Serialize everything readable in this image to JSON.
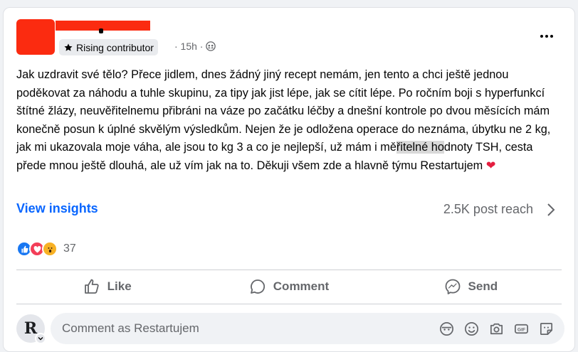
{
  "header": {
    "badge_label": "Rising contributor",
    "time": "· 15h ·"
  },
  "post": {
    "text_part1": "Jak uzdravit své tělo? Přece jidlem, dnes žádný jiný recept nemám, jen tento a chci ještě jednou poděkovat za náhodu a tuhle skupinu, za tipy jak jist lépe, jak se cítit lépe. Po ročním boji s hyperfunkcí štítné žlázy, neuvěřitelnemu přibráni  na váze po začátku léčby a dnešní kontrole po dvou měsících mám  konečně posun k úplné skvělým výsledkům. Nejen že je odložena operace do neznáma, úbytku ne 2 kg, jak mi ukazovala moje váha, ale jsou to kg 3 a co je nejlepší, už mám i mě",
    "text_highlight": "řitelné ho",
    "text_part2": "dnoty TSH, cesta přede mnou ještě dlouhá, ale už vím jak na to. Děkuji všem zde a hlavně týmu Restartujem ",
    "text_emoji": "❤"
  },
  "insights": {
    "view_label": "View insights",
    "reach": "2.5K post reach"
  },
  "reactions": {
    "count": "37",
    "types": [
      "like",
      "love",
      "wow"
    ]
  },
  "actions": {
    "like": "Like",
    "comment": "Comment",
    "send": "Send"
  },
  "composer": {
    "avatar_letter": "R",
    "placeholder": "Comment as Restartujem"
  },
  "colors": {
    "link_blue": "#0866ff",
    "muted": "#65676b",
    "redaction": "#fb2b10"
  }
}
